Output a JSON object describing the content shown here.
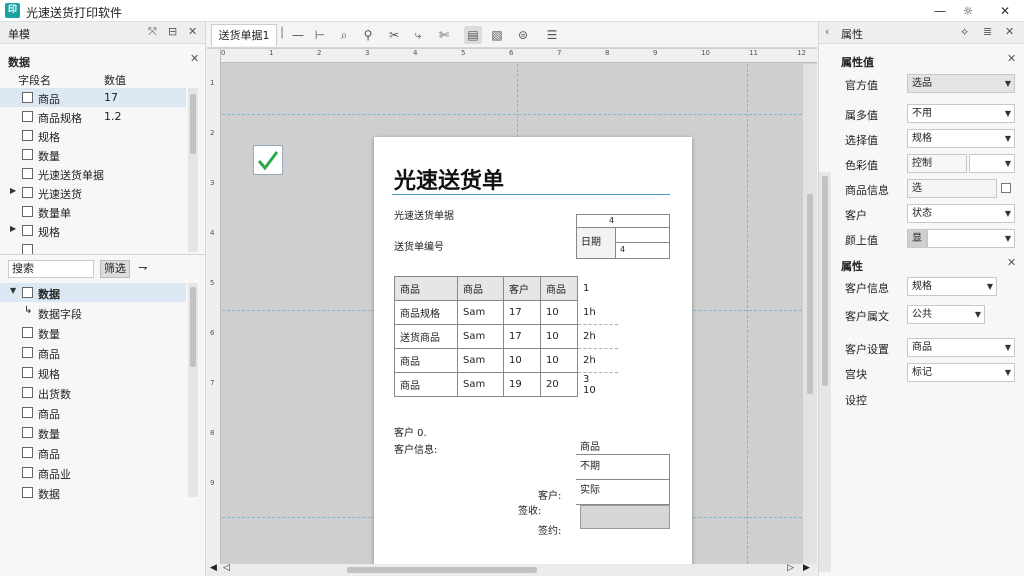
{
  "window": {
    "app_icon": "印",
    "title": "光速送货打印软件",
    "minimize": "—",
    "maximize": "☼",
    "close": "✕"
  },
  "left_panel": {
    "header": "单模",
    "data_section_title": "数据",
    "columns": [
      "字段名",
      "数值"
    ],
    "data_rows": [
      {
        "label": "商品",
        "value": "17"
      },
      {
        "label": "商品规格",
        "value": "1.2"
      },
      {
        "label": "规格",
        "value": ""
      },
      {
        "label": "数量",
        "value": ""
      },
      {
        "label": "光速送货单据",
        "value": ""
      },
      {
        "label": "光速送货",
        "value": ""
      },
      {
        "label": "数量单",
        "value": ""
      },
      {
        "label": "规格",
        "value": ""
      },
      {
        "label": "",
        "value": ""
      }
    ],
    "search_label": "搜索",
    "filter_button": "筛选",
    "tree_rows": [
      {
        "label": "数据"
      },
      {
        "label": "数据字段"
      },
      {
        "label": "数量"
      },
      {
        "label": "商品"
      },
      {
        "label": "规格"
      },
      {
        "label": "出货数"
      },
      {
        "label": "商品"
      },
      {
        "label": "数量"
      },
      {
        "label": "商品"
      },
      {
        "label": "商品业"
      },
      {
        "label": "数据"
      }
    ]
  },
  "center": {
    "doc_tab": "送货单据1",
    "toolbar_icons": [
      "line-h-icon",
      "line-v-icon",
      "zoom-icon",
      "search-icon",
      "cut-icon",
      "pen-icon",
      "scissors-icon",
      "layout-icon",
      "preview-icon",
      "print-icon",
      "list-icon"
    ],
    "page": {
      "title": "光速送货单",
      "subtitle": "光速送货单据",
      "delivery_label": "送货单编号",
      "box_top_right": "4",
      "box_label": "日期",
      "box_num": "4",
      "table": {
        "headers": [
          "商品",
          "商品",
          "客户",
          "商品",
          "1"
        ],
        "rows": [
          [
            "商品规格",
            "Sam",
            "17",
            "10",
            "1h"
          ],
          [
            "送货商品",
            "Sam",
            "17",
            "10",
            "2h"
          ],
          [
            "商品",
            "Sam",
            "10",
            "10",
            "2h"
          ],
          [
            "商品",
            "Sam",
            "19",
            "20",
            "3\n10"
          ]
        ]
      },
      "customer_label": "客户 0.",
      "customer_info_label": "客户信息:",
      "right_box_title": "商品",
      "right_box_row1": "不期",
      "right_box_row2": "实际",
      "sign_label1": "客户:",
      "sign_label2": "签收:",
      "sign_label3": "签约:"
    }
  },
  "right_panel": {
    "header": "属性",
    "section1_title": "属性值",
    "rows1": [
      {
        "key": "官方值",
        "value": "选品"
      },
      {
        "key": "属多值",
        "value": "不用"
      },
      {
        "key": "选择值",
        "value": "规格"
      },
      {
        "key": "色彩值",
        "value": "控制"
      },
      {
        "key": "商品信息",
        "value": "选"
      },
      {
        "key": "客户",
        "value": "状态"
      },
      {
        "key": "颜上值",
        "value": "显"
      }
    ],
    "section2_title": "属性",
    "rows2": [
      {
        "key": "客户信息",
        "value": "规格"
      },
      {
        "key": "客户属文",
        "value": "公共"
      },
      {
        "key": "客户设置",
        "value": "商品"
      },
      {
        "key": "宫块",
        "value": "标记"
      }
    ],
    "footer": "设控"
  }
}
